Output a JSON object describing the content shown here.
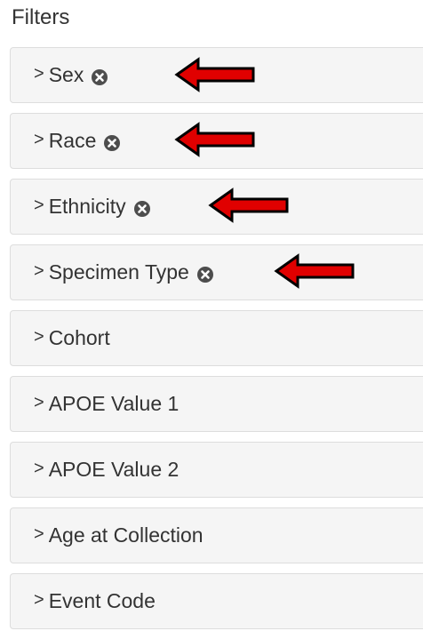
{
  "heading": "Filters",
  "filters": [
    {
      "label": "Sex",
      "clearable": true,
      "highlighted": true
    },
    {
      "label": "Race",
      "clearable": true,
      "highlighted": true
    },
    {
      "label": "Ethnicity",
      "clearable": true,
      "highlighted": true
    },
    {
      "label": "Specimen Type",
      "clearable": true,
      "highlighted": true
    },
    {
      "label": "Cohort",
      "clearable": false,
      "highlighted": false
    },
    {
      "label": "APOE Value 1",
      "clearable": false,
      "highlighted": false
    },
    {
      "label": "APOE Value 2",
      "clearable": false,
      "highlighted": false
    },
    {
      "label": "Age at Collection",
      "clearable": false,
      "highlighted": false
    },
    {
      "label": "Event Code",
      "clearable": false,
      "highlighted": false
    }
  ],
  "icons": {
    "chevron": "chevron-right-icon",
    "clear": "clear-filter-icon",
    "annotation": "red-arrow-annotation"
  },
  "colors": {
    "panel_background": "#f5f5f5",
    "panel_border": "#dddddd",
    "text": "#333333",
    "clear_icon": "#4d4d4d",
    "arrow_fill": "#e00000",
    "arrow_outline": "#000000"
  }
}
